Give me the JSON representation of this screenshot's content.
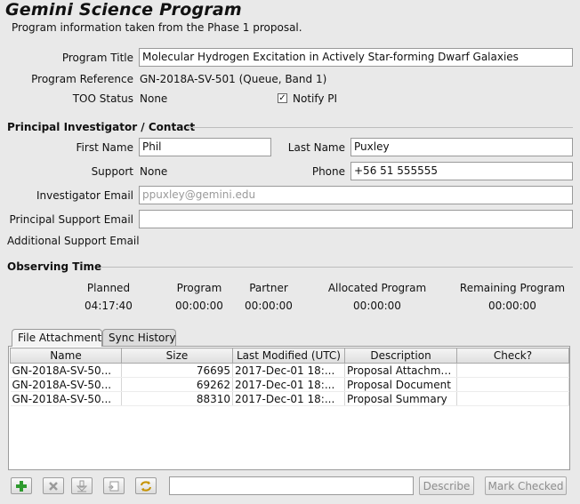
{
  "header": {
    "title": "Gemini Science Program",
    "subtitle": "Program information taken from the Phase 1 proposal."
  },
  "program": {
    "title_label": "Program Title",
    "title_value": "Molecular Hydrogen Excitation in Actively Star-forming Dwarf Galaxies",
    "reference_label": "Program Reference",
    "reference_value": "GN-2018A-SV-501 (Queue, Band 1)",
    "too_label": "TOO Status",
    "too_value": "None",
    "notify_label": "Notify PI",
    "notify_checked": true
  },
  "pi": {
    "section_title": "Principal Investigator / Contact",
    "first_name_label": "First Name",
    "first_name_value": "Phil",
    "last_name_label": "Last Name",
    "last_name_value": "Puxley",
    "support_label": "Support",
    "support_value": "None",
    "phone_label": "Phone",
    "phone_value": "+56 51 555555",
    "inv_email_label": "Investigator Email",
    "inv_email_value": "ppuxley@gemini.edu",
    "ps_email_label": "Principal Support Email",
    "ps_email_value": "",
    "add_support_label": "Additional Support Email"
  },
  "observing": {
    "section_title": "Observing Time",
    "columns": [
      {
        "label": "Planned",
        "value": "04:17:40"
      },
      {
        "label": "Program",
        "value": "00:00:00"
      },
      {
        "label": "Partner",
        "value": "00:00:00"
      },
      {
        "label": "Allocated Program",
        "value": "00:00:00"
      },
      {
        "label": "Remaining Program",
        "value": "00:00:00"
      }
    ]
  },
  "tabs": [
    {
      "label": "File Attachment",
      "active": true
    },
    {
      "label": "Sync History",
      "active": false
    }
  ],
  "attachments": {
    "headers": [
      "Name",
      "Size",
      "Last Modified (UTC)",
      "Description",
      "Check?"
    ],
    "rows": [
      [
        "GN-2018A-SV-50...",
        "76695",
        "2017-Dec-01 18:...",
        "Proposal Attachment",
        ""
      ],
      [
        "GN-2018A-SV-50...",
        "69262",
        "2017-Dec-01 18:...",
        "Proposal Document",
        ""
      ],
      [
        "GN-2018A-SV-50...",
        "88310",
        "2017-Dec-01 18:...",
        "Proposal Summary",
        ""
      ]
    ]
  },
  "toolbar": {
    "icons": [
      "add-icon",
      "remove-icon",
      "download-icon",
      "export-icon",
      "refresh-icon"
    ],
    "description_value": "",
    "describe_label": "Describe",
    "mark_checked_label": "Mark Checked"
  },
  "colors": {
    "background": "#e9e9e9",
    "add_green": "#2e9a2e",
    "disabled_text": "#8d8d8d"
  }
}
